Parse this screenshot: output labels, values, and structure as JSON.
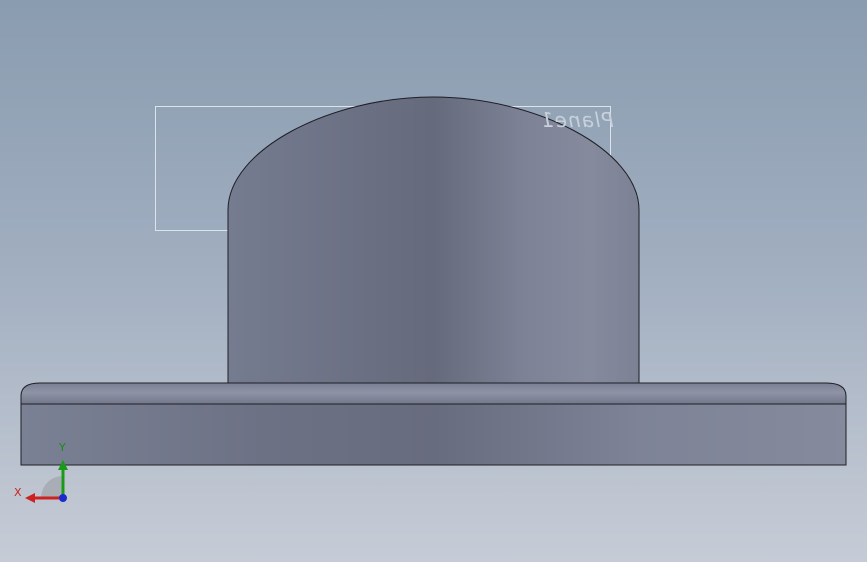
{
  "viewport": {
    "plane_label": "Plane1",
    "colors": {
      "background_top": "#8a9cb0",
      "background_bottom": "#c6ccd6",
      "part_body": "#6e7488",
      "part_edge": "#1e1f26",
      "plane_border": "#dde3ea"
    }
  },
  "triad": {
    "x_label": "X",
    "y_label": "Y",
    "colors": {
      "x_axis": "#cc2222",
      "y_axis": "#1a9a1a",
      "z_axis": "#1a2acc"
    }
  }
}
